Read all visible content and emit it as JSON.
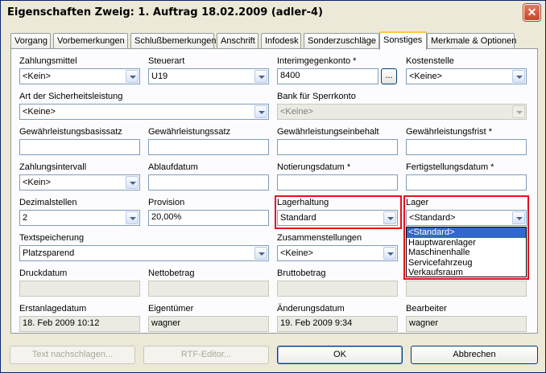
{
  "window": {
    "title": "Eigenschaften Zweig: 1. Auftrag 18.02.2009 (adler-4)",
    "close_label": "✕"
  },
  "tabs": [
    "Vorgang",
    "Vorbemerkungen",
    "Schlußbemerkungen",
    "Anschrift",
    "Infodesk",
    "Sonderzuschläge",
    "Sonstiges",
    "Merkmale & Optionen"
  ],
  "active_tab": "Sonstiges",
  "form": {
    "zahlungsmittel": {
      "label": "Zahlungsmittel",
      "value": "<Kein>"
    },
    "steuerart": {
      "label": "Steuerart",
      "value": "U19"
    },
    "interimgegenkonto": {
      "label": "Interimgegenkonto *",
      "value": "8400",
      "button": "..."
    },
    "kostenstelle": {
      "label": "Kostenstelle",
      "value": "<Keine>"
    },
    "art_sicherheitsleistung": {
      "label": "Art der Sicherheitsleistung",
      "value": "<Keine>"
    },
    "bank_sperrkonto": {
      "label": "Bank für Sperrkonto",
      "value": "<Keine>"
    },
    "gewaehrleistungsbasissatz": {
      "label": "Gewährleistungsbasissatz",
      "value": ""
    },
    "gewaehrleistungssatz": {
      "label": "Gewährleistungssatz",
      "value": ""
    },
    "gewaehrleistungseinbehalt": {
      "label": "Gewährleistungseinbehalt",
      "value": ""
    },
    "gewaehrleistungsfrist": {
      "label": "Gewährleistungsfrist *",
      "value": ""
    },
    "zahlungsintervall": {
      "label": "Zahlungsintervall",
      "value": "<Kein>"
    },
    "ablaufdatum": {
      "label": "Ablaufdatum",
      "value": ""
    },
    "notierungsdatum": {
      "label": "Notierungsdatum *",
      "value": ""
    },
    "fertigstellungsdatum": {
      "label": "Fertigstellungsdatum *",
      "value": ""
    },
    "dezimalstellen": {
      "label": "Dezimalstellen",
      "value": "2"
    },
    "provision": {
      "label": "Provision",
      "value": "20,00%"
    },
    "lagerhaltung": {
      "label": "Lagerhaltung",
      "value": "Standard"
    },
    "lager": {
      "label": "Lager",
      "value": "<Standard>",
      "options": [
        "<Standard>",
        "Hauptwarenlager",
        "Maschinenhalle",
        "Servicefahrzeug",
        "Verkaufsraum"
      ]
    },
    "textspeicherung": {
      "label": "Textspeicherung",
      "value": "Platzsparend"
    },
    "zusammenstellungen": {
      "label": "Zusammenstellungen",
      "value": "<Keine>"
    },
    "druckdatum": {
      "label": "Druckdatum",
      "value": ""
    },
    "nettobetrag": {
      "label": "Nettobetrag",
      "value": ""
    },
    "bruttobetrag": {
      "label": "Bruttobetrag",
      "value": ""
    },
    "erstanlagedatum": {
      "label": "Erstanlagedatum",
      "value": "18. Feb 2009 10:12"
    },
    "eigentuemer": {
      "label": "Eigentümer",
      "value": "wagner"
    },
    "aenderungsdatum": {
      "label": "Änderungsdatum",
      "value": "19. Feb 2009 9:34"
    },
    "bearbeiter": {
      "label": "Bearbeiter",
      "value": "wagner"
    }
  },
  "buttons": {
    "text_nachschlagen": "Text nachschlagen...",
    "rtf_editor": "RTF-Editor...",
    "ok": "OK",
    "abbrechen": "Abbrechen"
  },
  "colors": {
    "highlight": "#e8101a",
    "selection": "#316ac5",
    "window_bg": "#ece9d8"
  }
}
